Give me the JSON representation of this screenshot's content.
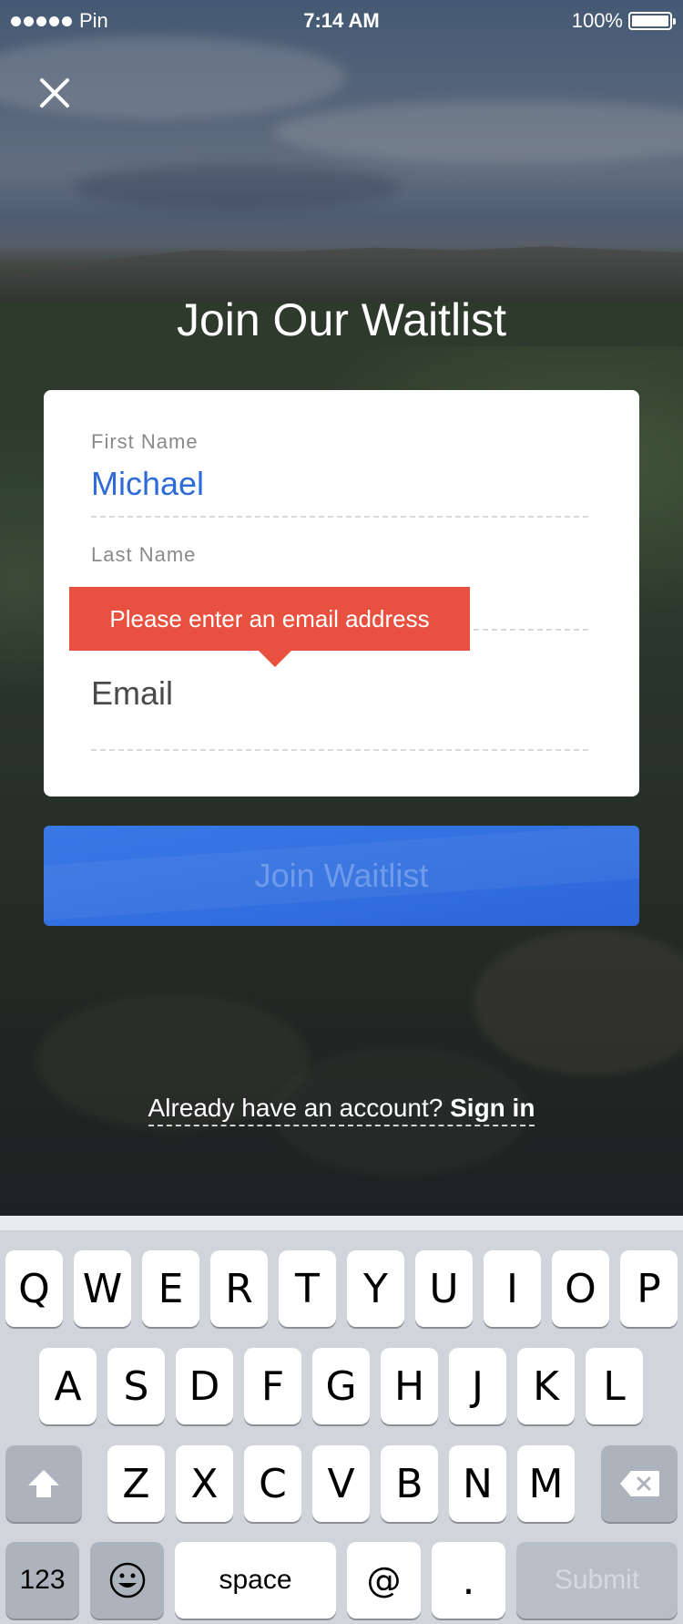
{
  "status_bar": {
    "carrier": "Pin",
    "time": "7:14 AM",
    "battery_percent": "100%",
    "battery_level": 1.0,
    "signal_bars": 5
  },
  "close_icon": "close-icon",
  "page_title": "Join Our Waitlist",
  "form": {
    "first_name": {
      "label": "First Name",
      "value": "Michael"
    },
    "last_name": {
      "label": "Last Name",
      "value": ""
    },
    "email": {
      "placeholder": "Email",
      "value": ""
    },
    "error_tooltip": "Please enter an email address"
  },
  "join_button": {
    "label": "Join Waitlist"
  },
  "signin": {
    "prompt": "Already have an account?",
    "link": "Sign in"
  },
  "keyboard": {
    "row1": [
      "Q",
      "W",
      "E",
      "R",
      "T",
      "Y",
      "U",
      "I",
      "O",
      "P"
    ],
    "row2": [
      "A",
      "S",
      "D",
      "F",
      "G",
      "H",
      "J",
      "K",
      "L"
    ],
    "row3": [
      "Z",
      "X",
      "C",
      "V",
      "B",
      "N",
      "M"
    ],
    "numbers_key": "123",
    "space_key": "space",
    "at_key": "@",
    "dot_key": ".",
    "submit_key": "Submit",
    "emoji_key": "emoji-icon",
    "shift_key": "shift-icon",
    "delete_key": "delete-icon"
  },
  "colors": {
    "accent_blue": "#2e6bd8",
    "error_red": "#e8513f",
    "button_blue": "#3270e0"
  }
}
